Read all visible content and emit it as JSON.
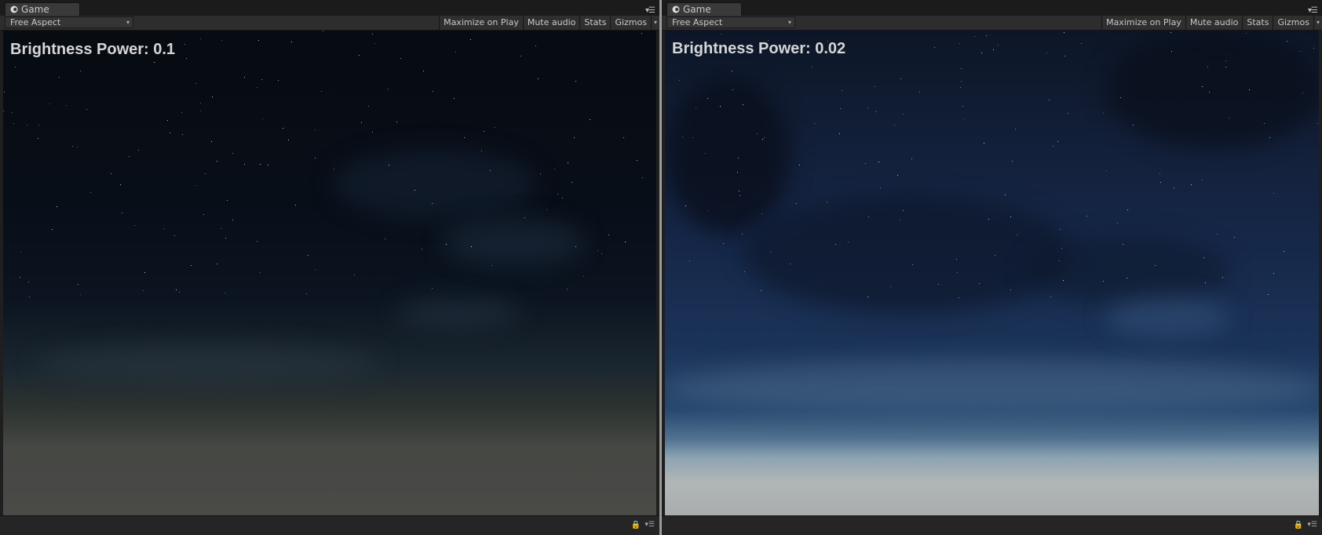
{
  "panels": [
    {
      "tab": {
        "label": "Game",
        "icon": "game-icon"
      },
      "toolbar": {
        "aspect": "Free Aspect",
        "buttons": [
          "Maximize on Play",
          "Mute audio",
          "Stats",
          "Gizmos"
        ]
      },
      "overlay": {
        "text": "Brightness Power: 0.1"
      },
      "status_icons": [
        "lock-icon",
        "menu-icon"
      ]
    },
    {
      "tab": {
        "label": "Game",
        "icon": "game-icon"
      },
      "toolbar": {
        "aspect": "Free Aspect",
        "buttons": [
          "Maximize on Play",
          "Mute audio",
          "Stats",
          "Gizmos"
        ]
      },
      "overlay": {
        "text": "Brightness Power: 0.02"
      },
      "status_icons": [
        "lock-icon",
        "menu-icon"
      ]
    }
  ],
  "colors": {
    "overlay_text": "#d6d6d6",
    "panel_bg": "#1f1f1f",
    "toolbar_bg": "#2d2d2d"
  }
}
